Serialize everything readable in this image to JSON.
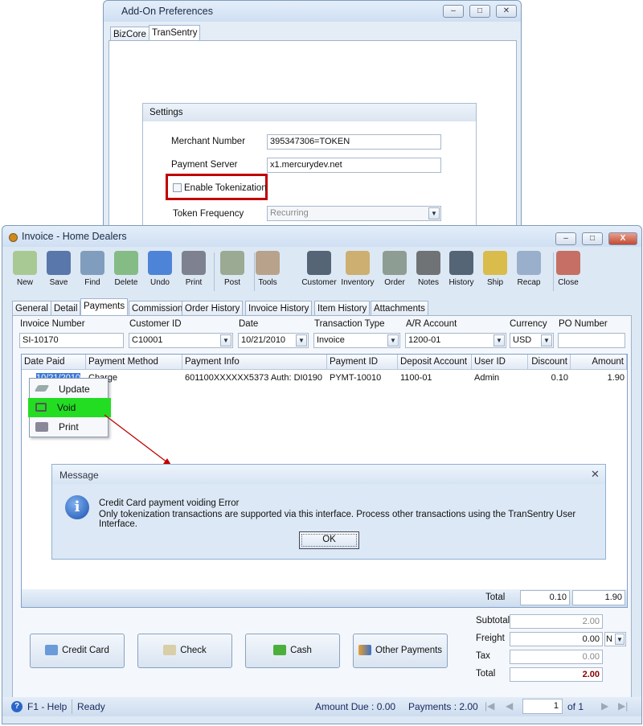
{
  "addon": {
    "title": "Add-On Preferences",
    "tabs": [
      "BizCore",
      "TranSentry"
    ],
    "settings_title": "Settings",
    "merchant_label": "Merchant Number",
    "merchant_value": "395347306=TOKEN",
    "server_label": "Payment Server",
    "server_value": "x1.mercurydev.net",
    "tokenization_label": "Enable Tokenization",
    "tokenization_checked": false,
    "frequency_label": "Token Frequency",
    "frequency_value": "Recurring",
    "highlight_color": "#c00000"
  },
  "invoice": {
    "title": "Invoice - Home Dealers",
    "toolbar": [
      "New",
      "Save",
      "Find",
      "Delete",
      "Undo",
      "Print",
      "Post",
      "Tools",
      "Customer",
      "Inventory",
      "Order",
      "Notes",
      "History",
      "Ship",
      "Recap",
      "Close"
    ],
    "tabs": [
      "General",
      "Detail",
      "Payments",
      "Commission",
      "Order History",
      "Invoice History",
      "Item History",
      "Attachments"
    ],
    "active_tab": "Payments",
    "fields": {
      "invoice_number_label": "Invoice Number",
      "invoice_number": "SI-10170",
      "customer_label": "Customer ID",
      "customer": "C10001",
      "date_label": "Date",
      "date": "10/21/2010",
      "type_label": "Transaction Type",
      "type": "Invoice",
      "ar_label": "A/R Account",
      "ar": "1200-01",
      "currency_label": "Currency",
      "currency": "USD",
      "po_label": "PO Number",
      "po": ""
    },
    "grid": {
      "columns": [
        "Date Paid",
        "Payment Method",
        "Payment Info",
        "Payment ID",
        "Deposit Account",
        "User ID",
        "Discount",
        "Amount"
      ],
      "rows": [
        [
          "10/21/2010",
          "Charge",
          "601100XXXXXX5373 Auth: DI0190",
          "PYMT-10010",
          "1100-01",
          "Admin",
          "0.10",
          "1.90"
        ]
      ],
      "total_label": "Total",
      "total_discount": "0.10",
      "total_amount": "1.90"
    },
    "context_menu": [
      "Update",
      "Void",
      "Print"
    ],
    "context_highlight": "#22dd22",
    "message": {
      "title": "Message",
      "line1": "Credit Card payment voiding Error",
      "line2": "Only tokenization transactions are supported via this interface.  Process other transactions using the TranSentry User Interface.",
      "ok": "OK"
    },
    "payment_buttons": [
      "Credit Card",
      "Check",
      "Cash",
      "Other Payments"
    ],
    "summary": {
      "subtotal_label": "Subtotal",
      "subtotal": "2.00",
      "freight_label": "Freight",
      "freight": "0.00",
      "freight_code": "N",
      "tax_label": "Tax",
      "tax": "0.00",
      "total_label": "Total",
      "total": "2.00"
    },
    "status": {
      "help": "F1 - Help",
      "state": "Ready",
      "amount_due": "Amount Due : 0.00",
      "payments": "Payments : 2.00",
      "page": "1",
      "of": "of 1"
    }
  }
}
